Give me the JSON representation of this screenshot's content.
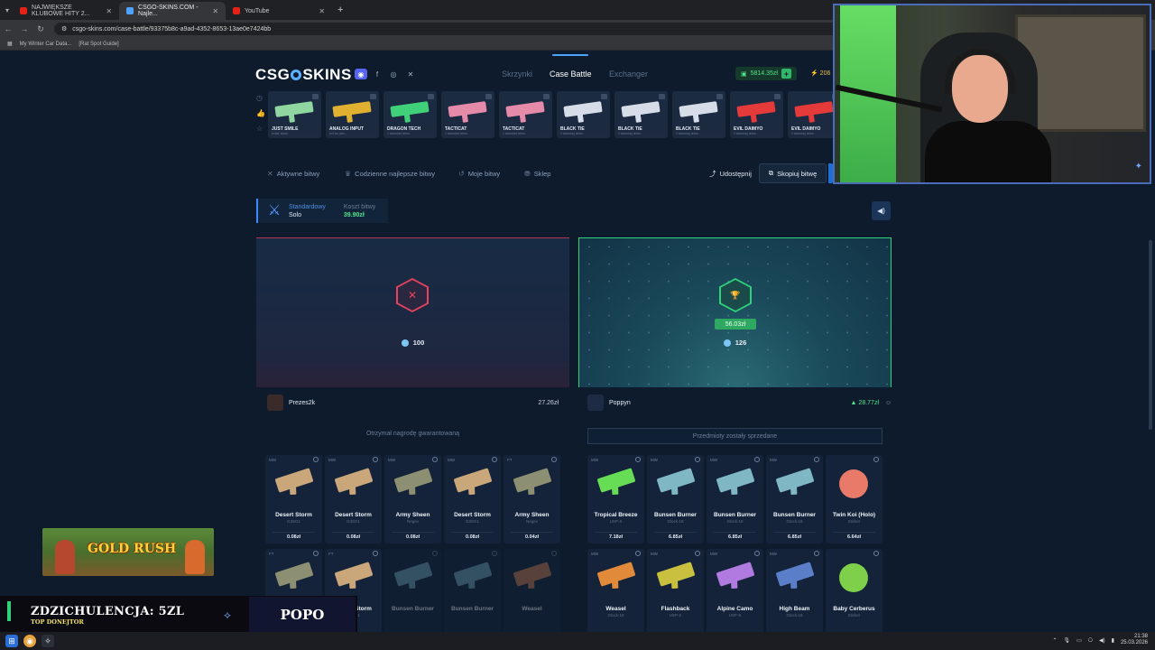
{
  "browser": {
    "tabs": [
      {
        "title": "NAJWIĘKSZE KLUBOWE HITY 2...",
        "fav_color": "#e62117",
        "active": false
      },
      {
        "title": "CSGO-SKINS.COM - Najle...",
        "fav_color": "#4ea3ff",
        "active": true
      },
      {
        "title": "YouTube",
        "fav_color": "#e62117",
        "active": false
      }
    ],
    "new_tab": "+",
    "url": "csgo-skins.com/case-battle/93375b8c-a9ad-4352-8653-13ae0e7424bb",
    "bookmarks": [
      "My Winter Car Data...",
      "[Rat Spot Guide]"
    ]
  },
  "header": {
    "logo_left": "CSG",
    "logo_right": "SKINS",
    "social_icons": [
      "discord-icon",
      "facebook-icon",
      "instagram-icon",
      "x-icon"
    ],
    "nav": [
      "Skrzynki",
      "Case Battle",
      "Exchanger"
    ],
    "active_nav": "Case Battle",
    "balance": "5814.35zł",
    "balance_plus": "+",
    "level": "206"
  },
  "live_drops": [
    {
      "name": "JUST SMILE",
      "sub": "m4a1 stock",
      "color": "#8fd6a0"
    },
    {
      "name": "ANALOG INPUT",
      "sub": "m4 for aim...",
      "color": "#e0b030"
    },
    {
      "name": "DRAGON TECH",
      "sub": "1 sekunde temu",
      "color": "#41d07a"
    },
    {
      "name": "TACTICAT",
      "sub": "1 sekunde temu",
      "color": "#e58aa8"
    },
    {
      "name": "TACTICAT",
      "sub": "1 sekunde temu",
      "color": "#e58aa8"
    },
    {
      "name": "BLACK TIE",
      "sub": "2 sekundy temu",
      "color": "#d7dde8"
    },
    {
      "name": "BLACK TIE",
      "sub": "2 sekundy temu",
      "color": "#d7dde8"
    },
    {
      "name": "BLACK TIE",
      "sub": "2 sekundy temu",
      "color": "#d7dde8"
    },
    {
      "name": "EVIL DAIMYO",
      "sub": "2 sekundy temu",
      "color": "#e53a3a"
    },
    {
      "name": "EVIL DAIMYO",
      "sub": "2 sekundy temu",
      "color": "#e53a3a"
    }
  ],
  "subnav": {
    "items": [
      "Aktywne bitwy",
      "Codzienne najlepsze bitwy",
      "Moje bitwy",
      "Sklep"
    ],
    "share": "Udostępnij",
    "copy": "Skopiuj bitwę"
  },
  "battle": {
    "mode_label": "Standardowy",
    "mode_value": "Solo",
    "cost_label": "Koszt bitwy",
    "cost_value": "39.90zł",
    "left": {
      "tickets": "100",
      "player": "Prezes2k",
      "total": "27.26zł",
      "notice": "Otrzymał nagrodę gwarantowaną"
    },
    "right": {
      "prize": "56.03zł",
      "tickets": "126",
      "player": "Poppyn",
      "total": "28.77zł",
      "notice": "Przedmioty zostały sprzedane"
    }
  },
  "left_items": [
    {
      "cond": "MW",
      "name": "Desert Storm",
      "type": "G3SG1",
      "price": "0.08zł",
      "color": "#c9a77a"
    },
    {
      "cond": "MW",
      "name": "Desert Storm",
      "type": "G3SG1",
      "price": "0.08zł",
      "color": "#c9a77a"
    },
    {
      "cond": "MW",
      "name": "Army Sheen",
      "type": "Negev",
      "price": "0.08zł",
      "color": "#8d8f72"
    },
    {
      "cond": "MW",
      "name": "Desert Storm",
      "type": "G3SG1",
      "price": "0.08zł",
      "color": "#c9a77a"
    },
    {
      "cond": "FT",
      "name": "Army Sheen",
      "type": "Negev",
      "price": "0.04zł",
      "color": "#8d8f72"
    },
    {
      "cond": "FT",
      "name": "Desert Storm",
      "type": "G3SG1",
      "price": "",
      "color": "#8d8f72"
    },
    {
      "cond": "FT",
      "name": "Desert Storm",
      "type": "G3SG1",
      "price": "",
      "color": "#c9a77a"
    },
    {
      "cond": "",
      "name": "Bunsen Burner",
      "type": "",
      "price": "",
      "color": "#6fa3b0"
    },
    {
      "cond": "",
      "name": "Bunsen Burner",
      "type": "",
      "price": "",
      "color": "#6fa3b0"
    },
    {
      "cond": "",
      "name": "Weasel",
      "type": "",
      "price": "",
      "color": "#c87a50"
    }
  ],
  "right_items": [
    {
      "cond": "MW",
      "name": "Tropical Breeze",
      "type": "USP-S",
      "price": "7.18zł",
      "color": "#66dd55"
    },
    {
      "cond": "MW",
      "name": "Bunsen Burner",
      "type": "Glock-18",
      "price": "6.85zł",
      "color": "#7fb7c4"
    },
    {
      "cond": "MW",
      "name": "Bunsen Burner",
      "type": "Glock-18",
      "price": "6.85zł",
      "color": "#7fb7c4"
    },
    {
      "cond": "MW",
      "name": "Bunsen Burner",
      "type": "Glock-18",
      "price": "6.85zł",
      "color": "#7fb7c4"
    },
    {
      "cond": "",
      "name": "Twin Koi (Holo)",
      "type": "Sticker",
      "price": "6.64zł",
      "color": "#e97a6a"
    },
    {
      "cond": "MW",
      "name": "Weasel",
      "type": "Glock-18",
      "price": "",
      "color": "#e08a3a"
    },
    {
      "cond": "MW",
      "name": "Flashback",
      "type": "USP-S",
      "price": "",
      "color": "#c9c040"
    },
    {
      "cond": "MW",
      "name": "Alpine Camo",
      "type": "USP-S",
      "price": "",
      "color": "#b07ae0"
    },
    {
      "cond": "MW",
      "name": "High Beam",
      "type": "Glock-18",
      "price": "",
      "color": "#5a7ec8"
    },
    {
      "cond": "",
      "name": "Baby Cerberus",
      "type": "Sticker",
      "price": "",
      "color": "#7ed04a"
    }
  ],
  "overlay": {
    "game_title": "GOLD RUSH",
    "donor_text": "ZDZICHULENCJA: 5ZL",
    "donor_sub": "TOP DONEJTOR",
    "donor_name": "POPO"
  },
  "taskbar": {
    "time": "21:38",
    "date": "25.03.2026"
  }
}
